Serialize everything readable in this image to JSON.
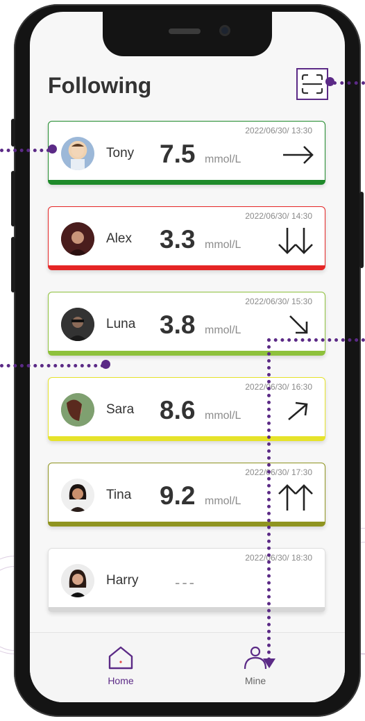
{
  "header": {
    "title": "Following"
  },
  "cards": [
    {
      "name": "Tony",
      "value": "7.5",
      "unit": "mmol/L",
      "timestamp": "2022/06/30/ 13:30",
      "trend": "steady-arrow",
      "color": "#1e8a2a"
    },
    {
      "name": "Alex",
      "value": "3.3",
      "unit": "mmol/L",
      "timestamp": "2022/06/30/ 14:30",
      "trend": "double-down-arrow",
      "color": "#e52525"
    },
    {
      "name": "Luna",
      "value": "3.8",
      "unit": "mmol/L",
      "timestamp": "2022/06/30/ 15:30",
      "trend": "down-right-arrow",
      "color": "#8ec13c"
    },
    {
      "name": "Sara",
      "value": "8.6",
      "unit": "mmol/L",
      "timestamp": "2022/06/30/ 16:30",
      "trend": "up-right-arrow",
      "color": "#e6e32a"
    },
    {
      "name": "Tina",
      "value": "9.2",
      "unit": "mmol/L",
      "timestamp": "2022/06/30/ 17:30",
      "trend": "double-up-arrow",
      "color": "#8f9420"
    },
    {
      "name": "Harry",
      "value": "---",
      "unit": "",
      "timestamp": "2022/06/30/ 18:30",
      "trend": "none",
      "color": "#dcdcdc"
    }
  ],
  "tabs": [
    {
      "label": "Home",
      "icon": "home-icon",
      "active": true
    },
    {
      "label": "Mine",
      "icon": "person-icon",
      "active": false
    }
  ],
  "accent": "#5b2a86"
}
